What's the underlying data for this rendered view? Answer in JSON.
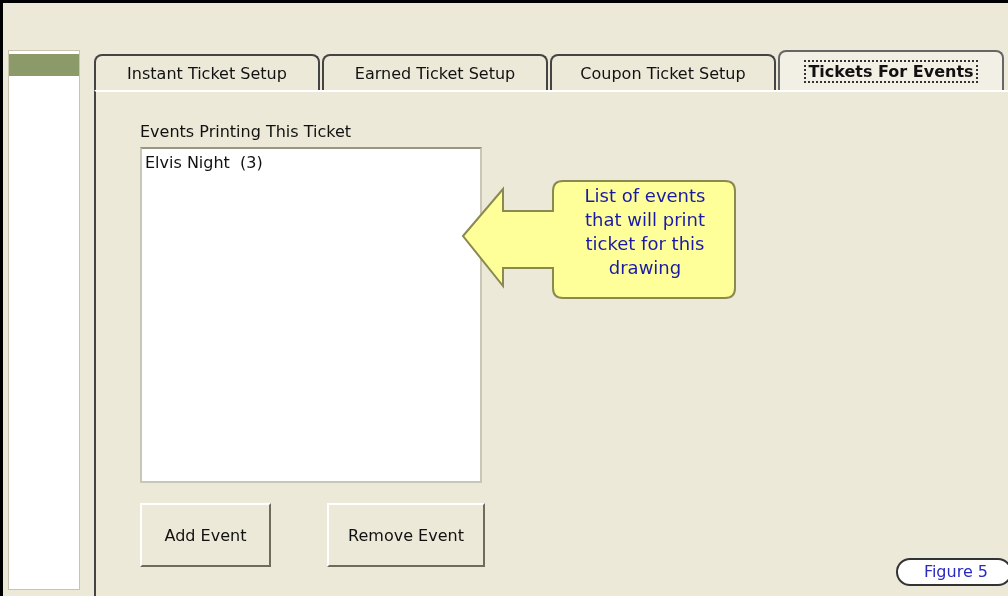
{
  "tabs": [
    {
      "label": "Instant Ticket Setup",
      "selected": false
    },
    {
      "label": "Earned Ticket Setup",
      "selected": false
    },
    {
      "label": "Coupon Ticket Setup",
      "selected": false
    },
    {
      "label": "Tickets For Events",
      "selected": true
    }
  ],
  "events_list": {
    "label": "Events Printing This Ticket",
    "items": [
      "Elvis Night  (3)"
    ]
  },
  "buttons": [
    "Add Event",
    "Remove Event"
  ],
  "callout": {
    "text": "List of events\nthat will print\nticket for this\ndrawing"
  },
  "figure_label": "Figure 5"
}
